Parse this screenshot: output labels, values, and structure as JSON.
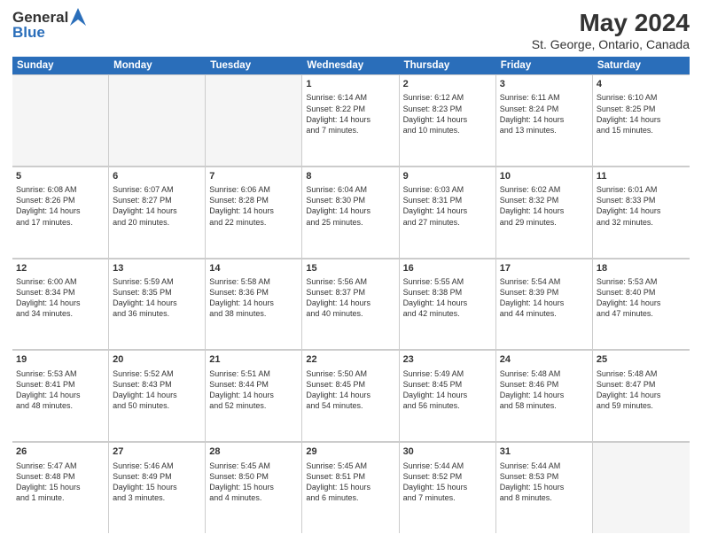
{
  "header": {
    "logo_line1": "General",
    "logo_line2": "Blue",
    "title": "May 2024",
    "subtitle": "St. George, Ontario, Canada"
  },
  "calendar": {
    "days": [
      "Sunday",
      "Monday",
      "Tuesday",
      "Wednesday",
      "Thursday",
      "Friday",
      "Saturday"
    ],
    "weeks": [
      [
        {
          "day": "",
          "content": ""
        },
        {
          "day": "",
          "content": ""
        },
        {
          "day": "",
          "content": ""
        },
        {
          "day": "1",
          "content": "Sunrise: 6:14 AM\nSunset: 8:22 PM\nDaylight: 14 hours\nand 7 minutes."
        },
        {
          "day": "2",
          "content": "Sunrise: 6:12 AM\nSunset: 8:23 PM\nDaylight: 14 hours\nand 10 minutes."
        },
        {
          "day": "3",
          "content": "Sunrise: 6:11 AM\nSunset: 8:24 PM\nDaylight: 14 hours\nand 13 minutes."
        },
        {
          "day": "4",
          "content": "Sunrise: 6:10 AM\nSunset: 8:25 PM\nDaylight: 14 hours\nand 15 minutes."
        }
      ],
      [
        {
          "day": "5",
          "content": "Sunrise: 6:08 AM\nSunset: 8:26 PM\nDaylight: 14 hours\nand 17 minutes."
        },
        {
          "day": "6",
          "content": "Sunrise: 6:07 AM\nSunset: 8:27 PM\nDaylight: 14 hours\nand 20 minutes."
        },
        {
          "day": "7",
          "content": "Sunrise: 6:06 AM\nSunset: 8:28 PM\nDaylight: 14 hours\nand 22 minutes."
        },
        {
          "day": "8",
          "content": "Sunrise: 6:04 AM\nSunset: 8:30 PM\nDaylight: 14 hours\nand 25 minutes."
        },
        {
          "day": "9",
          "content": "Sunrise: 6:03 AM\nSunset: 8:31 PM\nDaylight: 14 hours\nand 27 minutes."
        },
        {
          "day": "10",
          "content": "Sunrise: 6:02 AM\nSunset: 8:32 PM\nDaylight: 14 hours\nand 29 minutes."
        },
        {
          "day": "11",
          "content": "Sunrise: 6:01 AM\nSunset: 8:33 PM\nDaylight: 14 hours\nand 32 minutes."
        }
      ],
      [
        {
          "day": "12",
          "content": "Sunrise: 6:00 AM\nSunset: 8:34 PM\nDaylight: 14 hours\nand 34 minutes."
        },
        {
          "day": "13",
          "content": "Sunrise: 5:59 AM\nSunset: 8:35 PM\nDaylight: 14 hours\nand 36 minutes."
        },
        {
          "day": "14",
          "content": "Sunrise: 5:58 AM\nSunset: 8:36 PM\nDaylight: 14 hours\nand 38 minutes."
        },
        {
          "day": "15",
          "content": "Sunrise: 5:56 AM\nSunset: 8:37 PM\nDaylight: 14 hours\nand 40 minutes."
        },
        {
          "day": "16",
          "content": "Sunrise: 5:55 AM\nSunset: 8:38 PM\nDaylight: 14 hours\nand 42 minutes."
        },
        {
          "day": "17",
          "content": "Sunrise: 5:54 AM\nSunset: 8:39 PM\nDaylight: 14 hours\nand 44 minutes."
        },
        {
          "day": "18",
          "content": "Sunrise: 5:53 AM\nSunset: 8:40 PM\nDaylight: 14 hours\nand 47 minutes."
        }
      ],
      [
        {
          "day": "19",
          "content": "Sunrise: 5:53 AM\nSunset: 8:41 PM\nDaylight: 14 hours\nand 48 minutes."
        },
        {
          "day": "20",
          "content": "Sunrise: 5:52 AM\nSunset: 8:43 PM\nDaylight: 14 hours\nand 50 minutes."
        },
        {
          "day": "21",
          "content": "Sunrise: 5:51 AM\nSunset: 8:44 PM\nDaylight: 14 hours\nand 52 minutes."
        },
        {
          "day": "22",
          "content": "Sunrise: 5:50 AM\nSunset: 8:45 PM\nDaylight: 14 hours\nand 54 minutes."
        },
        {
          "day": "23",
          "content": "Sunrise: 5:49 AM\nSunset: 8:45 PM\nDaylight: 14 hours\nand 56 minutes."
        },
        {
          "day": "24",
          "content": "Sunrise: 5:48 AM\nSunset: 8:46 PM\nDaylight: 14 hours\nand 58 minutes."
        },
        {
          "day": "25",
          "content": "Sunrise: 5:48 AM\nSunset: 8:47 PM\nDaylight: 14 hours\nand 59 minutes."
        }
      ],
      [
        {
          "day": "26",
          "content": "Sunrise: 5:47 AM\nSunset: 8:48 PM\nDaylight: 15 hours\nand 1 minute."
        },
        {
          "day": "27",
          "content": "Sunrise: 5:46 AM\nSunset: 8:49 PM\nDaylight: 15 hours\nand 3 minutes."
        },
        {
          "day": "28",
          "content": "Sunrise: 5:45 AM\nSunset: 8:50 PM\nDaylight: 15 hours\nand 4 minutes."
        },
        {
          "day": "29",
          "content": "Sunrise: 5:45 AM\nSunset: 8:51 PM\nDaylight: 15 hours\nand 6 minutes."
        },
        {
          "day": "30",
          "content": "Sunrise: 5:44 AM\nSunset: 8:52 PM\nDaylight: 15 hours\nand 7 minutes."
        },
        {
          "day": "31",
          "content": "Sunrise: 5:44 AM\nSunset: 8:53 PM\nDaylight: 15 hours\nand 8 minutes."
        },
        {
          "day": "",
          "content": ""
        }
      ]
    ]
  }
}
